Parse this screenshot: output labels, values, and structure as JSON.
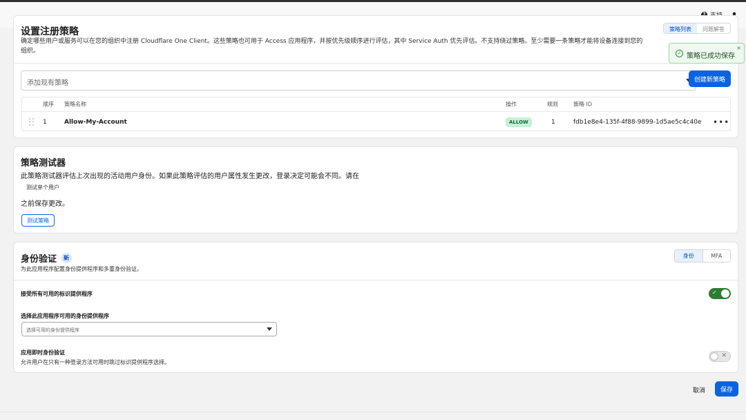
{
  "topbar": {
    "support_label": "支持"
  },
  "policy_card": {
    "title": "设置注册策略",
    "description": "确定哪些用户或服务可以在您的组织中注册 Cloudflare One Client。这些策略也可用于 Access 应用程序，并按优先级顺序进行评估，其中 Service Auth 优先评估。不支持绕过策略。至少需要一条策略才能将设备连接到您的组织。",
    "tabs": [
      "策略列表",
      "问题解答"
    ],
    "add_placeholder": "添加现有策略",
    "create_button": "创建新策略",
    "table": {
      "headers": {
        "order": "顺序",
        "name": "策略名称",
        "action": "操作",
        "rules": "规则",
        "id": "策略 ID"
      },
      "rows": [
        {
          "order": "1",
          "name": "Allow-My-Account",
          "action": "ALLOW",
          "rules": "1",
          "id": "fdb1e8e4-135f-4f88-9899-1d5ae5c4c40e"
        }
      ]
    }
  },
  "toast": {
    "message": "策略已成功保存",
    "close": "×"
  },
  "tester_card": {
    "title": "策略测试器",
    "paragraph1": "此策略测试器评估上次出现的活动用户身份。如果此策略评估的用户属性发生更改，登录决定可能会不同。请在",
    "link": "测试单个用户",
    "paragraph2": "之前保存更改。",
    "test_button": "测试策略"
  },
  "auth_card": {
    "title": "身份验证",
    "badge": "新",
    "subtitle": "为此应用程序配置身份提供程序和多重身份验证。",
    "tabs": {
      "identity": "身份",
      "mfa": "MFA"
    },
    "accept_all_label": "接受所有可用的标识提供程序",
    "accept_all_on": true,
    "select_idp_label": "选择此应用程序可用的身份提供程序",
    "select_idp_placeholder": "选择可用的身份提供程序",
    "instant_auth_label": "应用即时身份验证",
    "instant_auth_desc": "允许用户在只有一种登录方法可用时跳过标识提供程序选择。",
    "instant_auth_on": false
  },
  "footer": {
    "cancel": "取消",
    "save": "保存"
  },
  "colors": {
    "primary": "#0a63e0",
    "success": "#2e7d32",
    "allow_badge_bg": "#c9efd6"
  }
}
